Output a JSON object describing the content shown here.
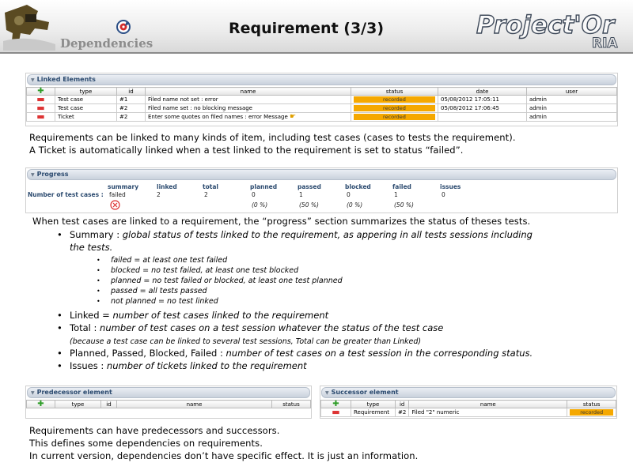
{
  "header": {
    "section": "Dependencies",
    "title": "Requirement (3/3)",
    "logo_text": "Project'Or",
    "logo_sub": "RIA"
  },
  "linked": {
    "title": "Linked Elements",
    "columns": [
      "type",
      "id",
      "name",
      "status",
      "date",
      "user"
    ],
    "rows": [
      {
        "type": "Test case",
        "id": "#1",
        "name": "Filed name not set : error",
        "status": "recorded",
        "date": "05/08/2012 17:05:11",
        "user": "admin"
      },
      {
        "type": "Test case",
        "id": "#2",
        "name": "Filed name set : no blocking message",
        "status": "recorded",
        "date": "05/08/2012 17:06:45",
        "user": "admin"
      },
      {
        "type": "Ticket",
        "id": "#2",
        "name": "Enter some quotes on filed names : error Message",
        "status": "recorded",
        "date": "",
        "user": "admin"
      }
    ]
  },
  "text1": [
    "Requirements can be linked to many kinds of item, including test cases (cases to tests the requirement).",
    "A Ticket is automatically linked when a test linked to the requirement is set to status “failed”."
  ],
  "progress": {
    "title": "Progress",
    "row_label": "Number of test cases :",
    "headers": {
      "summary": "summary",
      "linked": "linked",
      "total": "total",
      "planned": "planned",
      "passed": "passed",
      "blocked": "blocked",
      "failed": "failed",
      "issues": "issues"
    },
    "values": {
      "summary": "failed",
      "linked": "2",
      "total": "2",
      "planned": "0",
      "passed": "1",
      "blocked": "0",
      "failed": "1",
      "issues": "0"
    },
    "percents": {
      "planned": "(0 %)",
      "passed": "(50 %)",
      "blocked": "(0 %)",
      "failed": "(50 %)"
    }
  },
  "text2": {
    "intro": "When test cases are linked to a requirement, the “progress” section summarizes the status of theses tests.",
    "summary_label": "Summary : ",
    "summary_desc": "global status of tests linked to the requirement, as appering in all tests sessions including the tests.",
    "summary_desc_l1": "global status of tests linked to the requirement, as appering in all tests sessions including",
    "summary_desc_l2": "the tests.",
    "sub": [
      "failed = at least one test failed",
      "blocked = no test failed, at least one test blocked",
      "planned = no test failed or blocked, at least one test planned",
      "passed = all tests passed",
      "not planned = no test linked"
    ],
    "linked_label": "Linked = ",
    "linked_desc": "number of test cases linked to the requirement",
    "total_label": "Total : ",
    "total_desc": "number of test cases on a test session whatever the status of the test case",
    "total_note": "(because a test case can be linked to several test sessions, Total can be greater than Linked)",
    "status_label": "Planned, Passed, Blocked, Failed : ",
    "status_desc": "number of test cases on a test session in the corresponding status.",
    "issues_label": "Issues : ",
    "issues_desc": "number of tickets linked to the requirement"
  },
  "predecessor": {
    "title": "Predecessor element",
    "columns": [
      "type",
      "id",
      "name",
      "status"
    ]
  },
  "successor": {
    "title": "Successor element",
    "columns": [
      "type",
      "id",
      "name",
      "status"
    ],
    "rows": [
      {
        "type": "Requirement",
        "id": "#2",
        "name": "Filed \"2\" numeric",
        "status": "recorded"
      }
    ]
  },
  "text3": [
    "Requirements can have predecessors and successors.",
    "This defines some dependencies on requirements.",
    "In current version, dependencies don’t have specific effect. It is just an information."
  ],
  "colors": {
    "status_recorded": "#f5a800",
    "panel_title": "#2b4a6f",
    "add": "#2c9c25",
    "remove": "#dd3333"
  }
}
